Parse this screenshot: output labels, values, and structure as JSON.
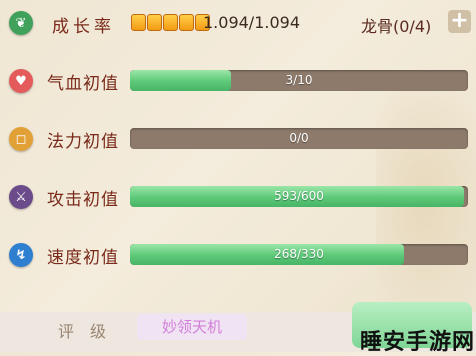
{
  "growth": {
    "label": "成长率",
    "pips": 5,
    "value": "1.094/1.094",
    "dragon_bone": "龙骨(0/4)",
    "plus": "+"
  },
  "stats": [
    {
      "label": "气血初值",
      "value": "3/10",
      "fraction": 0.3,
      "icon_color": "#e35b5b",
      "icon_name": "heart-icon",
      "glyph": "♥"
    },
    {
      "label": "法力初值",
      "value": "0/0",
      "fraction": 0.0,
      "icon_color": "#e2a136",
      "icon_name": "mana-square-icon",
      "glyph": "◻"
    },
    {
      "label": "攻击初值",
      "value": "593/600",
      "fraction": 0.988,
      "icon_color": "#6b4b8a",
      "icon_name": "sword-icon",
      "glyph": "⚔"
    },
    {
      "label": "速度初值",
      "value": "268/330",
      "fraction": 0.812,
      "icon_color": "#2f7fd0",
      "icon_name": "speed-icon",
      "glyph": "↯"
    }
  ],
  "footer": {
    "tab_rating": "评级",
    "tab_active": "妙领天机",
    "watermark": "睡安手游网"
  },
  "colors": {
    "bar_fill": "#5dc878",
    "bar_track": "#8d7a6b",
    "label_text": "#7a2a1a"
  }
}
